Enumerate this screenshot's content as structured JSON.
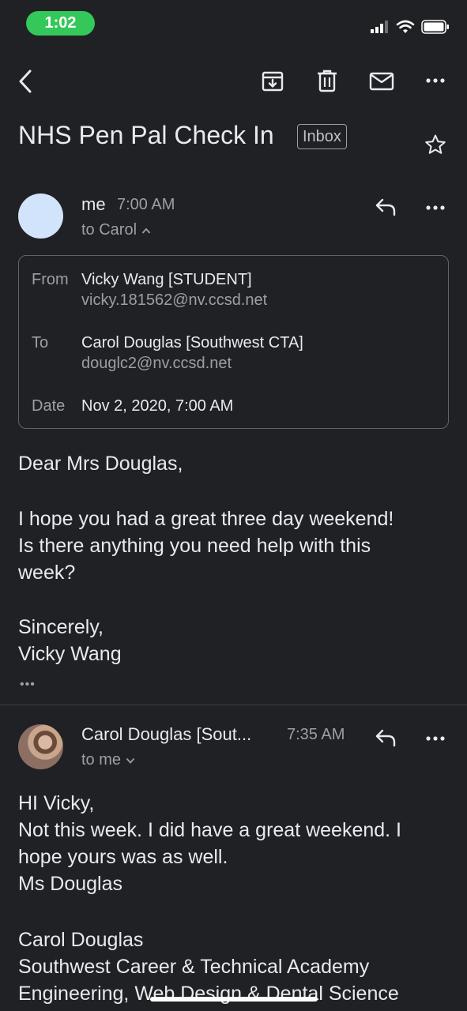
{
  "status_bar": {
    "time": "1:02"
  },
  "email": {
    "subject": "NHS Pen Pal Check In",
    "label": "Inbox",
    "messages": [
      {
        "sender": "me",
        "time": "7:00 AM",
        "to_line": "to Carol",
        "details": {
          "from_label": "From",
          "from_name": "Vicky Wang [STUDENT]",
          "from_email": "vicky.181562@nv.ccsd.net",
          "to_label": "To",
          "to_name": "Carol Douglas [Southwest CTA]",
          "to_email": "douglc2@nv.ccsd.net",
          "date_label": "Date",
          "date_value": "Nov 2, 2020, 7:00 AM"
        },
        "body": {
          "greeting": "Dear Mrs Douglas,",
          "line1": "I hope you had a great three day weekend!",
          "line2": "Is there anything you need help with this",
          "line3": "week?",
          "closing": "Sincerely,",
          "signature": "Vicky Wang"
        },
        "trimmed": "•••"
      },
      {
        "sender": "Carol Douglas [Sout...",
        "time": "7:35 AM",
        "to_line": "to me",
        "body": {
          "line1": "HI Vicky,",
          "line2": "Not this week. I did have a great weekend. I",
          "line3": "hope yours was as well.",
          "line4": "Ms Douglas",
          "sig1": "Carol Douglas",
          "sig2": "Southwest Career & Technical Academy",
          "sig3": "Engineering, Web Design & Dental Science"
        }
      }
    ]
  },
  "colors": {
    "background": "#202124",
    "text": "#e8eaed",
    "muted": "#9aa0a6",
    "time_pill": "#34c759",
    "avatar_me": "#d2e3fc"
  },
  "icons": {
    "back": "chevron-left-icon",
    "archive": "archive-icon",
    "delete": "trash-icon",
    "unread": "mail-icon",
    "more": "more-horizontal-icon",
    "star": "star-icon",
    "reply": "reply-icon",
    "expand": "chevron-up-icon",
    "collapse": "chevron-down-icon"
  }
}
